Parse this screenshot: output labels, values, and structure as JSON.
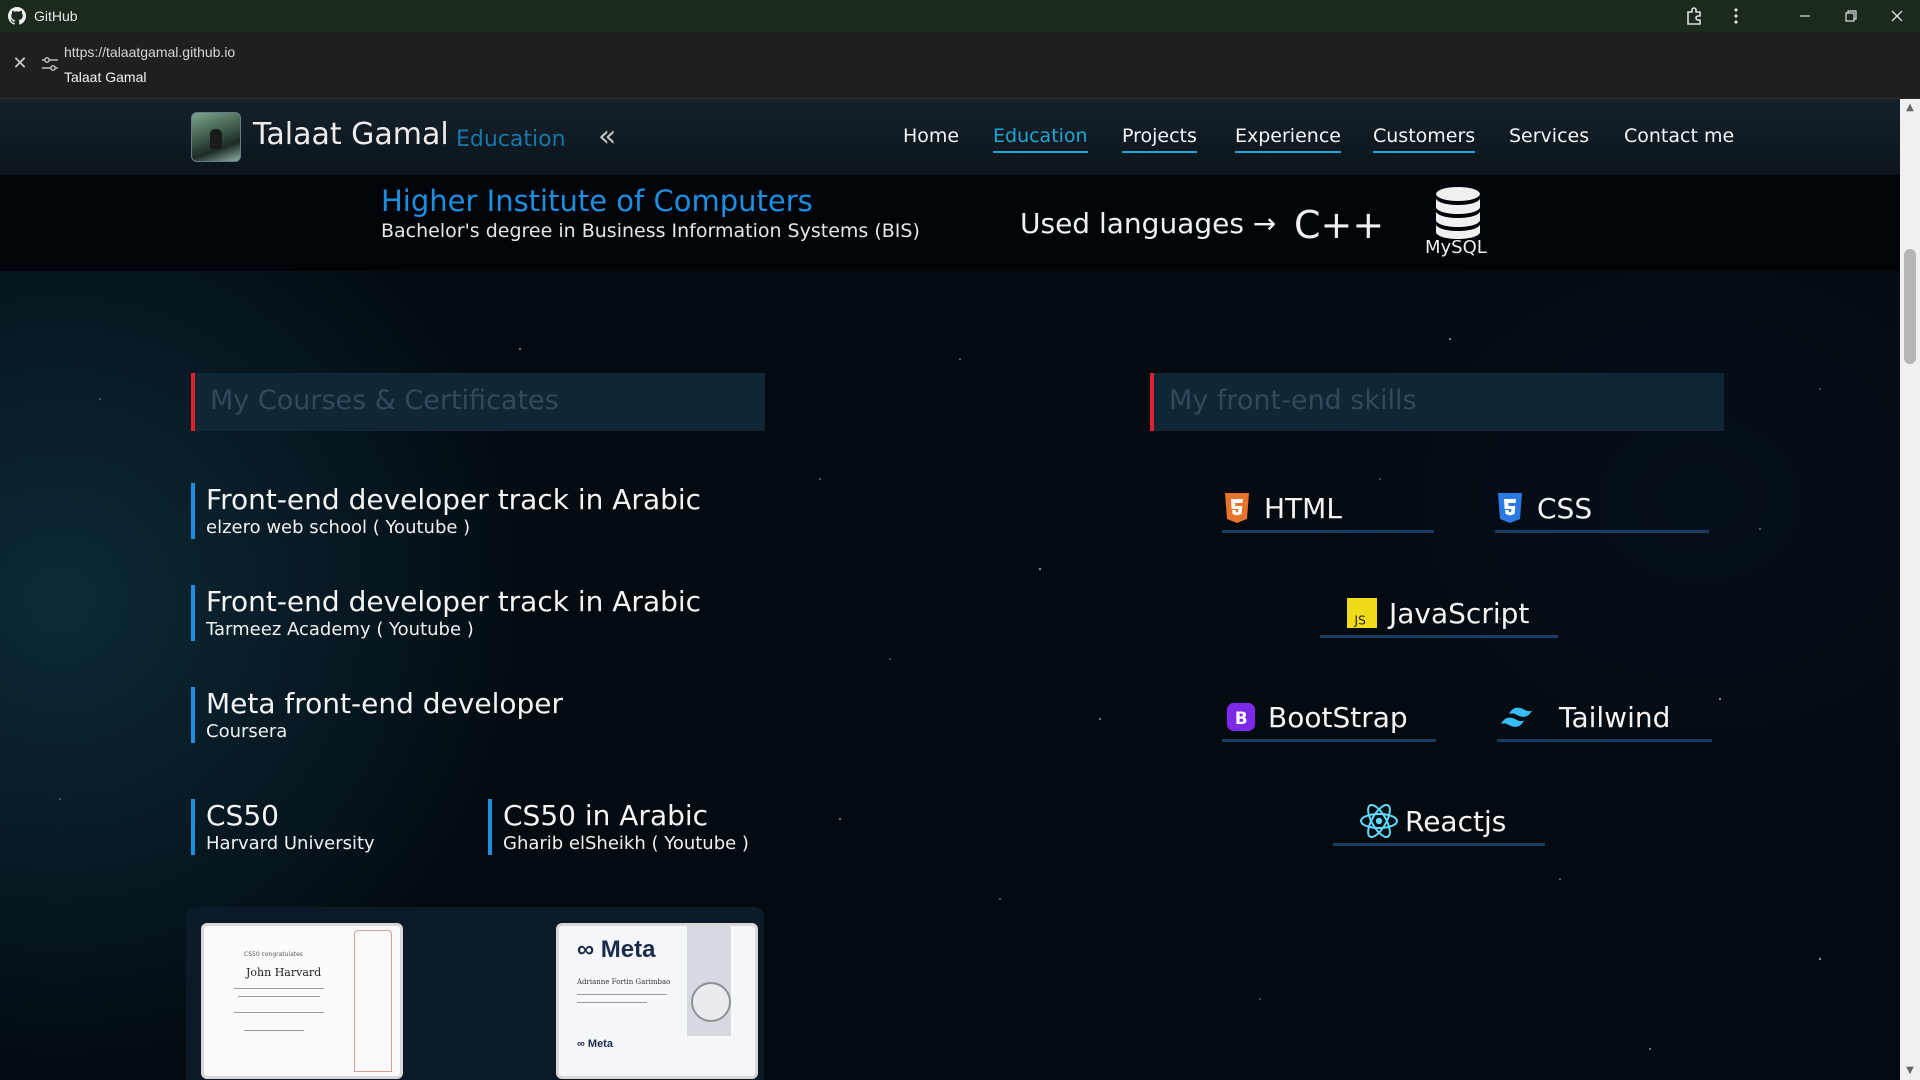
{
  "window": {
    "app_title": "GitHub",
    "url": "https://talaatgamal.github.io",
    "page_title": "Talaat Gamal"
  },
  "header": {
    "brand": "Talaat Gamal",
    "section": "Education",
    "collapse_glyph": "«",
    "nav": [
      {
        "label": "Home",
        "active": false
      },
      {
        "label": "Education",
        "active": true
      },
      {
        "label": "Projects",
        "active": false
      },
      {
        "label": "Experience",
        "active": false
      },
      {
        "label": "Customers",
        "active": false
      },
      {
        "label": "Services",
        "active": false
      },
      {
        "label": "Contact me",
        "active": false
      }
    ]
  },
  "institute": {
    "name": "Higher Institute of Computers",
    "degree": "Bachelor's degree in Business Information Systems (BIS)",
    "used_languages_label": "Used languages →",
    "languages": [
      "C++",
      "MySQL"
    ]
  },
  "courses_section": {
    "title": "My Courses & Certificates",
    "courses": [
      {
        "title": "Front-end developer track in Arabic",
        "provider": "elzero web school ( Youtube )"
      },
      {
        "title": "Front-end developer track in Arabic",
        "provider": "Tarmeez Academy ( Youtube )"
      },
      {
        "title": "Meta front-end developer",
        "provider": "Coursera"
      },
      {
        "title": "CS50",
        "provider": "Harvard University"
      },
      {
        "title": "CS50 in Arabic",
        "provider": "Gharib elSheikh ( Youtube )"
      }
    ],
    "certificates": [
      {
        "heading": "CS50 congratulates",
        "name": "John Harvard"
      },
      {
        "brand": "Meta",
        "name": "Adrianne Fortin Garimbao",
        "footer_brand": "Meta"
      }
    ]
  },
  "skills_section": {
    "title": "My front-end skills",
    "skills": [
      "HTML",
      "CSS",
      "JavaScript",
      "BootStrap",
      "Tailwind",
      "Reactjs"
    ]
  },
  "colors": {
    "accent_blue": "#1c8fe0",
    "nav_active": "#1ea6d6",
    "section_marker": "#e0202b",
    "html_orange": "#e8732a",
    "css_blue": "#2a7ae2",
    "js_yellow": "#f0db1a",
    "bootstrap_purple": "#7c2ae8",
    "tailwind_cyan": "#38bdf8",
    "react_blue": "#61dafb"
  }
}
